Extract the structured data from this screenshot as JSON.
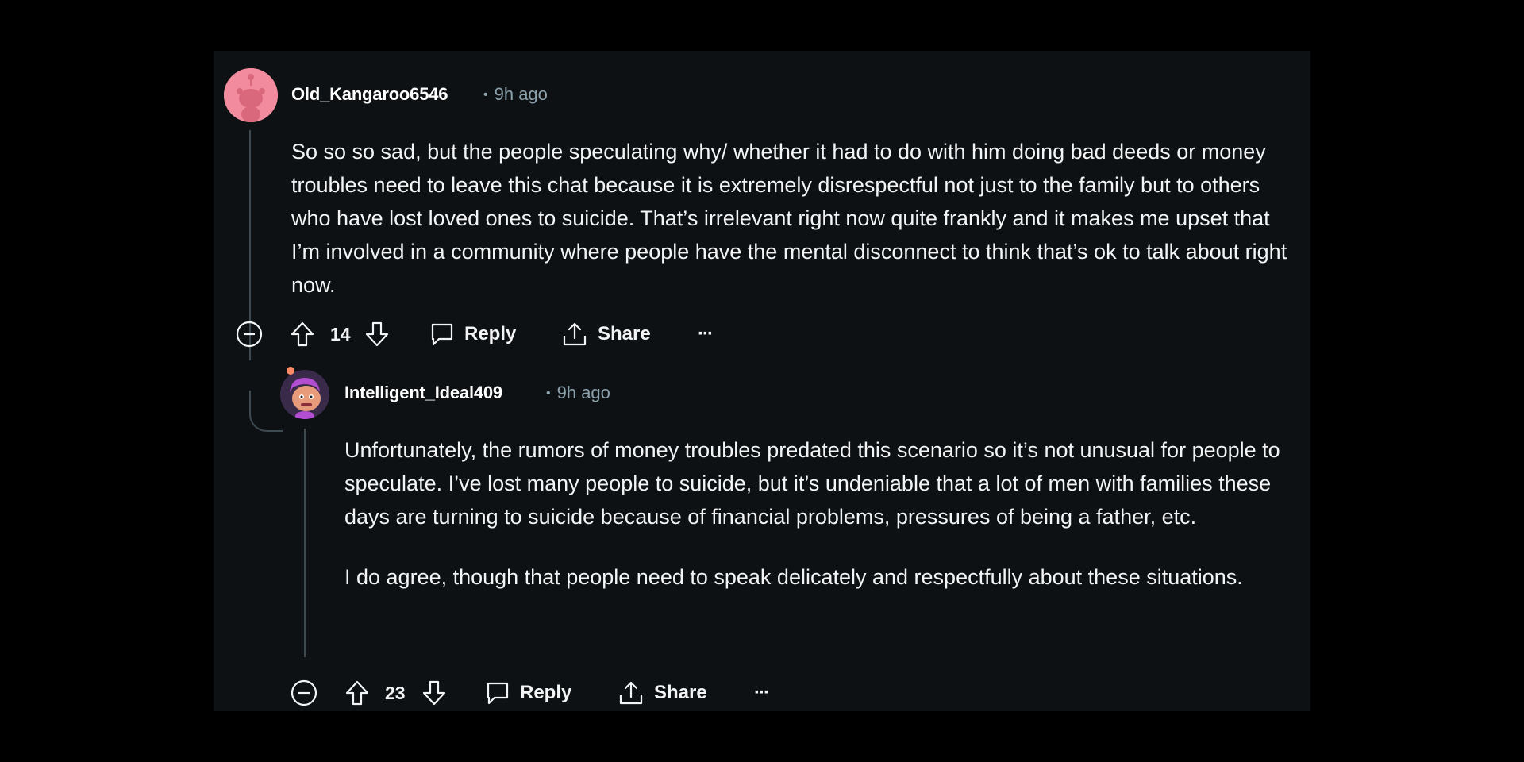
{
  "comments": [
    {
      "username": "Old_Kangaroo6546",
      "time_ago": "9h ago",
      "separator": "•",
      "body_paragraphs": [
        "So so so sad, but the people speculating why/ whether it had to do with him doing bad deeds or money troubles need to leave this chat because it is extremely disrespectful not just to the family but to others who have lost loved ones to suicide. That’s irrelevant right now quite frankly and it makes me upset that I’m involved in a community where people have the mental disconnect to think that’s ok to talk about right now."
      ],
      "vote_count": "14",
      "reply_label": "Reply",
      "share_label": "Share",
      "more_label": "···",
      "avatar_color": "#f28b9e"
    },
    {
      "username": "Intelligent_Ideal409",
      "time_ago": "9h ago",
      "separator": "•",
      "body_paragraphs": [
        "Unfortunately, the rumors of money troubles predated this scenario so it’s not unusual for people to speculate. I’ve lost many people to suicide, but it’s undeniable that a lot of men with families these days are turning to suicide because of financial problems, pressures of being a father, etc.",
        "I do agree, though that people need to speak delicately and respectfully about these situations."
      ],
      "vote_count": "23",
      "reply_label": "Reply",
      "share_label": "Share",
      "more_label": "···",
      "avatar_color": "#5a3a6e"
    }
  ],
  "colors": {
    "background": "#000000",
    "panel": "#0e1113",
    "text": "#f2f4f5",
    "meta": "#8ba2ad",
    "thread_line": "#3e4a52"
  }
}
